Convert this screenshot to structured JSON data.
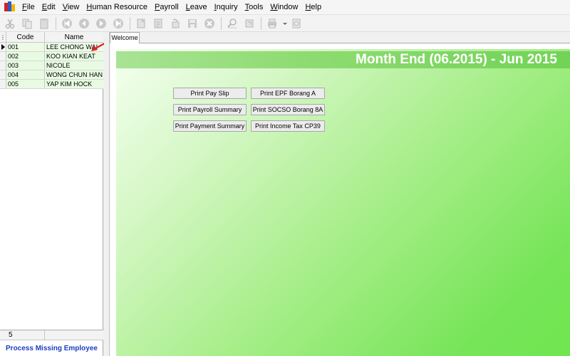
{
  "menu": {
    "items": [
      "File",
      "Edit",
      "View",
      "Human Resource",
      "Payroll",
      "Leave",
      "Inquiry",
      "Tools",
      "Window",
      "Help"
    ]
  },
  "toolbar": {
    "icons": [
      "cut-icon",
      "copy-icon",
      "paste-icon",
      "first-record-icon",
      "previous-record-icon",
      "next-record-icon",
      "last-record-icon",
      "new-icon",
      "edit-icon",
      "undo-icon",
      "save-icon",
      "delete-icon",
      "find-icon",
      "refresh-icon",
      "print-icon",
      "print-dropdown-icon",
      "preview-icon"
    ]
  },
  "employee_grid": {
    "headers": {
      "code": "Code",
      "name": "Name"
    },
    "rows": [
      {
        "code": "001",
        "name": "LEE CHONG WAI"
      },
      {
        "code": "002",
        "name": "KOO KIAN KEAT"
      },
      {
        "code": "003",
        "name": "NICOLE"
      },
      {
        "code": "004",
        "name": "WONG CHUN HAN"
      },
      {
        "code": "005",
        "name": "YAP KIM HOCK"
      }
    ],
    "count": "5"
  },
  "process_link": "Process Missing Employee",
  "tabs": {
    "welcome": "Welcome"
  },
  "banner": {
    "title": "Month End (06.2015) - Jun 2015"
  },
  "buttons": {
    "pay_slip": "Print Pay Slip",
    "epf": "Print EPF Borang A",
    "payroll_summary": "Print Payroll Summary",
    "socso": "Print SOCSO Borang 8A",
    "payment_summary": "Print Payment Summary",
    "income_tax": "Print Income Tax CP39"
  },
  "colors": {
    "banner_text": "#ffffff",
    "gradient_green": "#6fe64f",
    "link_blue": "#1a3ebf",
    "annotation_red": "#e02020"
  }
}
